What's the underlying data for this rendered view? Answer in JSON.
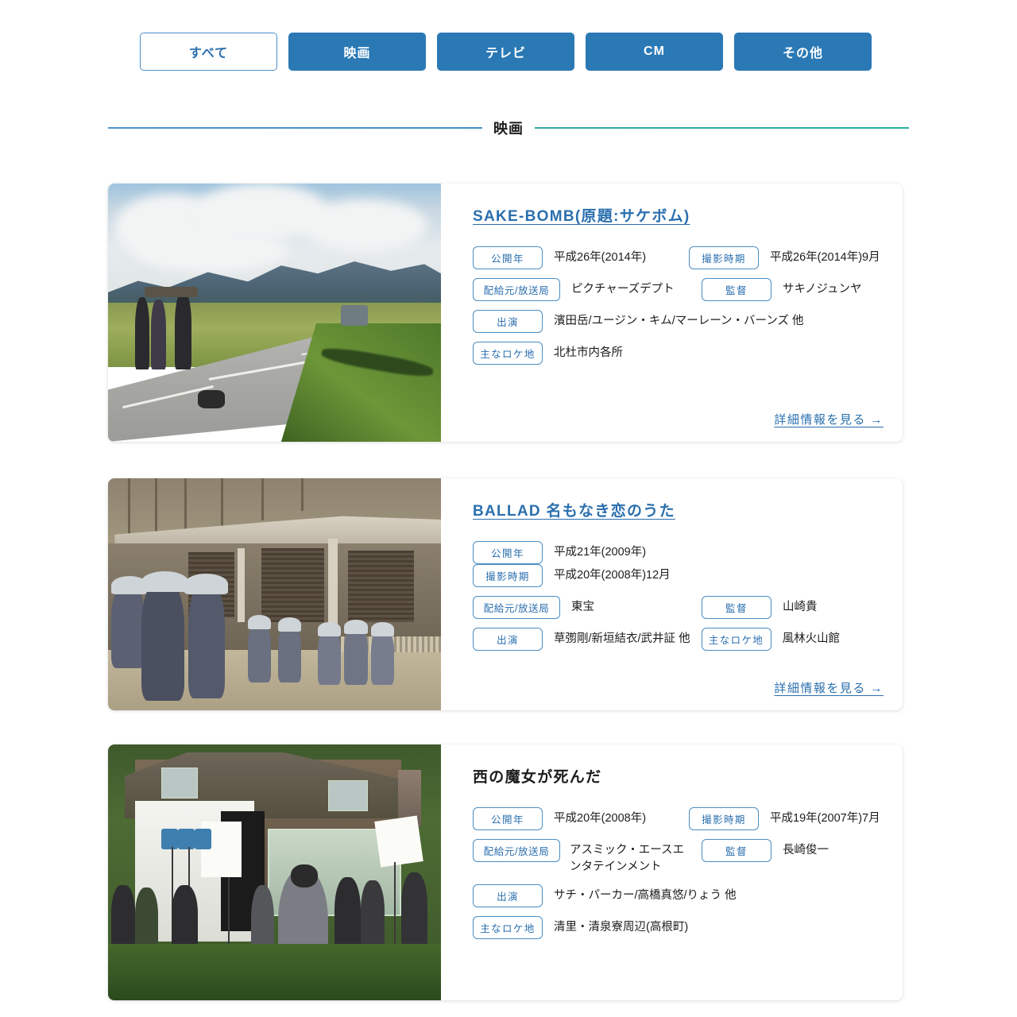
{
  "filter_tabs": [
    {
      "label": "すべて",
      "style": "outline",
      "selected": false
    },
    {
      "label": "映画",
      "style": "filled",
      "selected": true
    },
    {
      "label": "テレビ",
      "style": "filled",
      "selected": false
    },
    {
      "label": "CM",
      "style": "filled",
      "selected": false
    },
    {
      "label": "その他",
      "style": "filled",
      "selected": false
    }
  ],
  "section": {
    "title": "映画"
  },
  "labels": {
    "release_year": "公開年",
    "shoot_period": "撮影時期",
    "distributor": "配給元/放送局",
    "director": "監督",
    "cast": "出演",
    "location": "主なロケ地",
    "detail_link": "詳細情報を見る →"
  },
  "colors": {
    "accent_blue": "#2a79b5",
    "link_blue": "#2a6fae",
    "badge_border": "#4a8ec4",
    "rule_left": "#4a94cd",
    "rule_right": "#25b0a0",
    "text": "#1d1d1d"
  },
  "cards": [
    {
      "title": "SAKE-BOMB(原題:サケボム)",
      "title_is_link": true,
      "photo_alt": "撮影クルーと山道",
      "release_year": "平成26年(2014年)",
      "shoot_period": "平成26年(2014年)9月",
      "distributor": "ピクチャーズデプト",
      "director": "サキノジュンヤ",
      "cast": "濱田岳/ユージン・キム/マーレーン・バーンズ 他",
      "location": "北杜市内各所",
      "detail_link": "詳細情報を見る →"
    },
    {
      "title": "BALLAD 名もなき恋のうた",
      "title_is_link": true,
      "photo_alt": "甲冑姿の武者と日本家屋",
      "release_year": "平成21年(2009年)",
      "shoot_period": "平成20年(2008年)12月",
      "distributor": "東宝",
      "director": "山崎貴",
      "cast": "草彅剛/新垣結衣/武井証 他",
      "location": "風林火山館",
      "detail_link": "詳細情報を見る →"
    },
    {
      "title": "西の魔女が死んだ",
      "title_is_link": false,
      "photo_alt": "ログハウス前の撮影現場",
      "release_year": "平成20年(2008年)",
      "shoot_period": "平成19年(2007年)7月",
      "distributor": "アスミック・エースエンタテインメント",
      "director": "長崎俊一",
      "cast": "サチ・パーカー/高橋真悠/りょう 他",
      "location": "清里・清泉寮周辺(高根町)",
      "detail_link": ""
    }
  ]
}
